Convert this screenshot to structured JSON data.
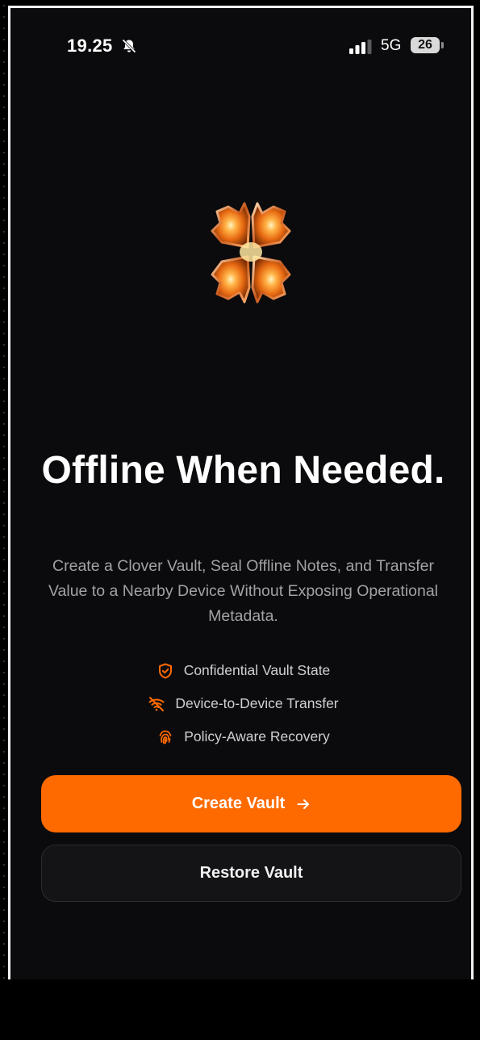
{
  "status_bar": {
    "time": "19.25",
    "network": "5G",
    "battery": "26",
    "icons": [
      "bell-slash-icon",
      "cellular-signal-icon"
    ]
  },
  "hero": {
    "logo_icon": "clover-logo-icon",
    "title": "Offline When Needed.",
    "subtitle": "Create a Clover Vault, Seal Offline Notes, and Transfer Value to a Nearby Device Without Exposing Operational Metadata."
  },
  "features": [
    {
      "icon": "shield-check-icon",
      "label": "Confidential Vault State"
    },
    {
      "icon": "wifi-off-icon",
      "label": "Device-to-Device Transfer"
    },
    {
      "icon": "fingerprint-icon",
      "label": "Policy-Aware Recovery"
    }
  ],
  "actions": {
    "primary_label": "Create Vault",
    "secondary_label": "Restore Vault"
  },
  "colors": {
    "accent": "#ff6a00",
    "background": "#0b0b0d",
    "text_primary": "#ffffff",
    "text_secondary": "#a1a1a6"
  }
}
